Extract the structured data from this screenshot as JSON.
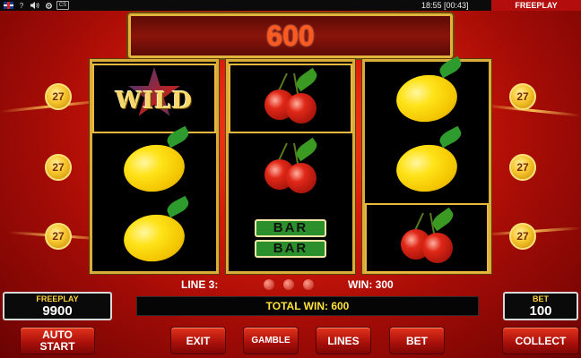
{
  "status_bar": {
    "flag_icon": "uk-flag-icon",
    "help_label": "?",
    "sound_icon": "speaker-icon",
    "settings_icon": "settings-icon",
    "card_label": "CS",
    "clock": "18:55 [00:43]",
    "mode": "FREEPLAY"
  },
  "win_banner": "600",
  "line_number_coins": [
    "27",
    "27",
    "27",
    "27",
    "27",
    "27"
  ],
  "reels": [
    [
      "wild",
      "lemon",
      "lemon"
    ],
    [
      "cherries",
      "cherries",
      "bar"
    ],
    [
      "lemon",
      "lemon",
      "cherries"
    ]
  ],
  "symbol_labels": {
    "wild": "WILD",
    "bar": "BAR"
  },
  "line_info": {
    "line": "LINE 3:",
    "win": "WIN: 300"
  },
  "total_win": "TOTAL WIN: 600",
  "freeplay_panel": {
    "label": "FREEPLAY",
    "value": "9900"
  },
  "bet_panel": {
    "label": "BET",
    "value": "100"
  },
  "buttons": {
    "auto_start": "AUTO\nSTART",
    "exit": "EXIT",
    "gamble": "GAMBLE",
    "lines": "LINES",
    "bet": "BET",
    "collect": "COLLECT"
  },
  "colors": {
    "banner_number": "#ff5a1e",
    "total_win_text": "#ffe23a",
    "button_red": "#c21a10",
    "reel_border": "#d9ad3a"
  }
}
